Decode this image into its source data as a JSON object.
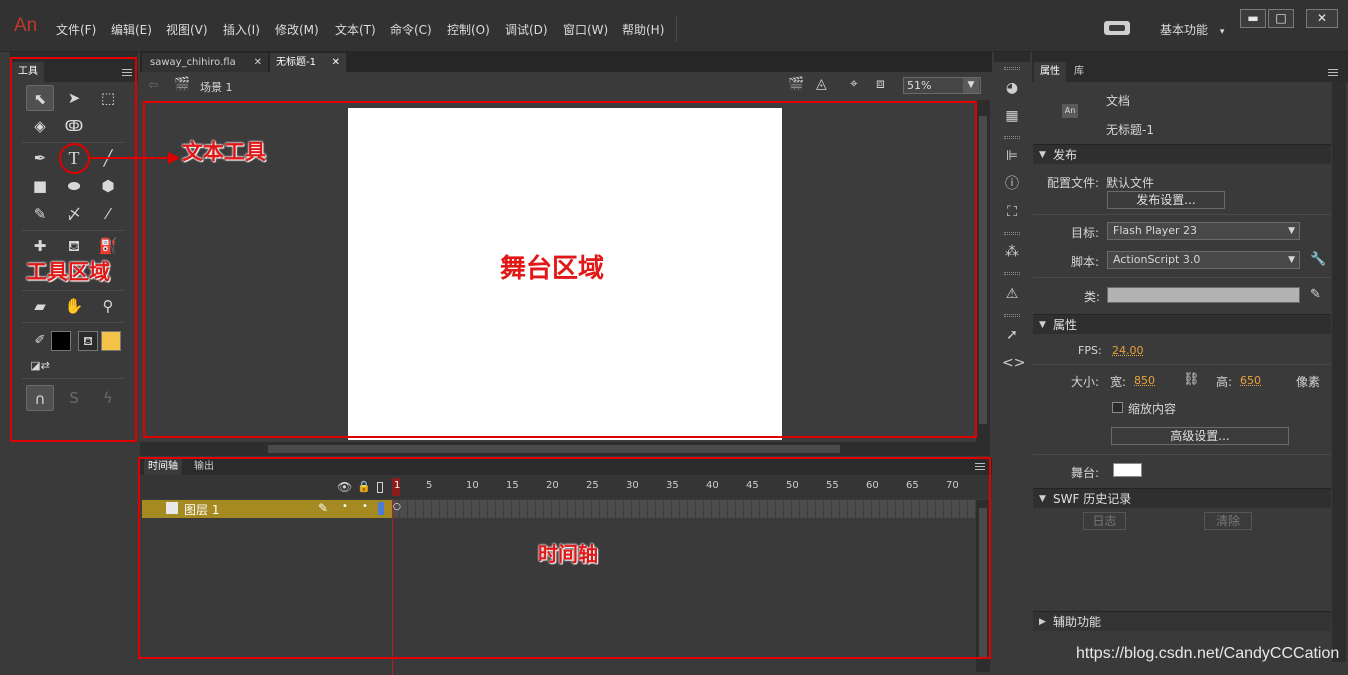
{
  "app": {
    "logo": "An"
  },
  "menu": [
    "文件(F)",
    "编辑(E)",
    "视图(V)",
    "插入(I)",
    "修改(M)",
    "文本(T)",
    "命令(C)",
    "控制(O)",
    "调试(D)",
    "窗口(W)",
    "帮助(H)"
  ],
  "workspace": {
    "label": "基本功能",
    "arrow": "▾"
  },
  "window_buttons": [
    "▬",
    "□",
    "✕"
  ],
  "tools_panel": {
    "title": "工具"
  },
  "doc_tabs": [
    {
      "label": "saway_chihiro.fla",
      "close": "✕"
    },
    {
      "label": "无标题-1",
      "close": "✕"
    }
  ],
  "edit_bar": {
    "scene": "场景 1",
    "zoom": "51%"
  },
  "timeline": {
    "tabs": [
      "时间轴",
      "输出"
    ],
    "layer_name": "图层 1",
    "frame_numbers": [
      "1",
      "5",
      "10",
      "15",
      "20",
      "25",
      "30",
      "35",
      "40",
      "45",
      "50",
      "55",
      "60",
      "65",
      "70"
    ]
  },
  "properties": {
    "tabs": [
      "属性",
      "库"
    ],
    "doc_icon": "An",
    "doc_type": "文档",
    "doc_name": "无标题-1",
    "publish_header": "发布",
    "profile_label": "配置文件:",
    "profile_value": "默认文件",
    "publish_settings_btn": "发布设置...",
    "target_label": "目标:",
    "target_value": "Flash Player 23",
    "script_label": "脚本:",
    "script_value": "ActionScript 3.0",
    "class_label": "类:",
    "props_header": "属性",
    "fps_label": "FPS:",
    "fps_value": "24.00",
    "size_label": "大小:",
    "width_label": "宽:",
    "width_value": "850",
    "height_label": "高:",
    "height_value": "650",
    "unit": "像素",
    "scale_label": "缩放内容",
    "advanced_btn": "高级设置...",
    "stage_label": "舞台:",
    "stage_color": "#ffffff",
    "swf_header": "SWF 历史记录",
    "log_btn": "日志",
    "clear_btn": "清除",
    "accessibility_header": "辅助功能"
  },
  "annotations": {
    "text_tool": "文本工具",
    "tools_area": "工具区域",
    "stage_area": "舞台区域",
    "timeline": "时间轴"
  },
  "watermark": "https://blog.csdn.net/CandyCCCation",
  "colors": {
    "accent": "#e00000",
    "orange": "#e8a23c",
    "layer": "#a58a22",
    "fill": "#f5c24a"
  }
}
